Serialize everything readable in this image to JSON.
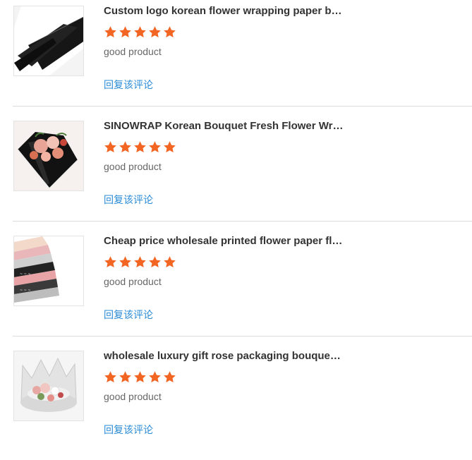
{
  "reviews": [
    {
      "product_title": "Custom logo korean flower wrapping paper bla...",
      "rating": 5,
      "comment": "good product",
      "reply_label": "回复该评论",
      "thumbnail": "black-white-wrapping-paper-rolls"
    },
    {
      "product_title": "SINOWRAP Korean Bouquet Fresh Flower Wrap...",
      "rating": 5,
      "comment": "good product",
      "reply_label": "回复该评论",
      "thumbnail": "flower-bouquet-black-wrap"
    },
    {
      "product_title": "Cheap price wholesale printed flower paper flo...",
      "rating": 5,
      "comment": "good product",
      "reply_label": "回复该评论",
      "thumbnail": "printed-paper-stack"
    },
    {
      "product_title": "wholesale luxury gift rose packaging bouquet ...",
      "rating": 5,
      "comment": "good product",
      "reply_label": "回复该评论",
      "thumbnail": "crown-flower-box"
    }
  ],
  "colors": {
    "star": "#f26522",
    "reply_link": "#2a8bd6",
    "title": "#333333",
    "comment": "#666666",
    "divider": "#dcdcdc"
  }
}
